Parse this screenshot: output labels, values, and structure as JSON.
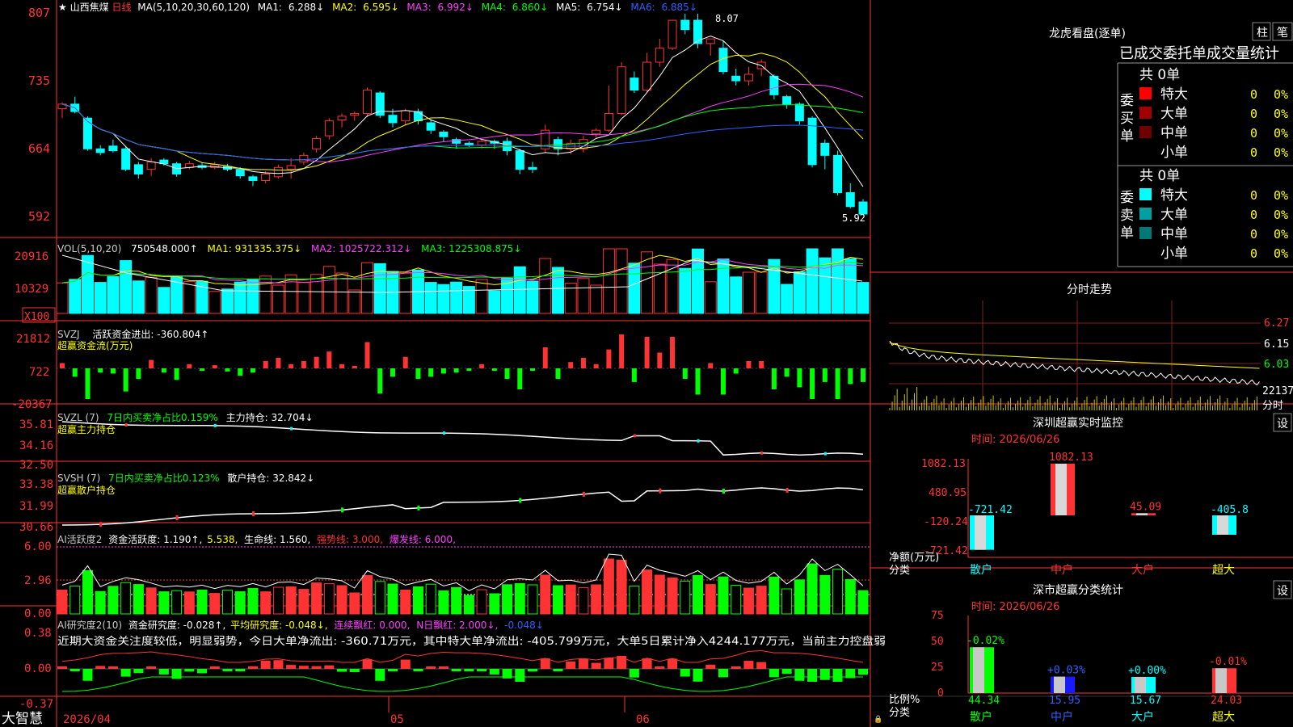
{
  "app": {
    "brand": "大智慧",
    "lock_glyph": "🔒"
  },
  "header": {
    "star": "★",
    "stock": "山西焦煤",
    "period": "日线",
    "ma_spec": "MA(5,10,20,30,60,120)",
    "ma1_label": "MA1:",
    "ma1_val": "6.288↓",
    "ma2_label": "MA2:",
    "ma2_val": "6.595↓",
    "ma3_label": "MA3:",
    "ma3_val": "6.992↓",
    "ma4_label": "MA4:",
    "ma4_val": "6.860↓",
    "ma5_label": "MA5:",
    "ma5_val": "6.754↓",
    "ma6_label": "MA6:",
    "ma6_val": "6.885↓"
  },
  "price_axis": [
    "807",
    "735",
    "664",
    "592"
  ],
  "price_marks": {
    "high": "8.07",
    "low": "5.92"
  },
  "vol": {
    "label": "VOL(5,10,20)",
    "val": "750548.000↑",
    "ma1": "MA1: 931335.375↓",
    "ma2": "MA2: 1025722.312↓",
    "ma3": "MA3: 1225308.875↓",
    "axis": [
      "20916",
      "10329"
    ],
    "unit": "X100"
  },
  "svzj": {
    "label": "SVZJ",
    "desc": "活跃资金进出: -360.804↑",
    "title": "超赢资金流(万元)",
    "axis": [
      "21812",
      "722",
      "-20367"
    ]
  },
  "svzl": {
    "label": "SVZL (7)",
    "desc": "7日内买卖净占比0.159%",
    "hold": "主力持仓: 32.704↓",
    "title": "超赢主力持仓",
    "axis": [
      "35.81",
      "34.16",
      "32.50"
    ]
  },
  "svsh": {
    "label": "SVSH (7)",
    "desc": "7日内买卖净占比0.123%",
    "hold": "散户持仓: 32.842↓",
    "title": "超赢散户持仓",
    "axis": [
      "33.38",
      "31.99",
      "30.66"
    ]
  },
  "ai_act": {
    "label": "AI活跃度2",
    "a": "资金活跃度: 1.190↑,",
    "b": "5.538,",
    "c": "生命线: 1.560,",
    "d": "强势线: 3.000,",
    "e": "爆发线: 6.000,",
    "axis": [
      "6.00",
      "2.96",
      "0.00"
    ]
  },
  "ai_res": {
    "label": "AI研究度2(10)",
    "a": "资金研究度: -0.028↑,",
    "b": "平均研究度: -0.048↓,",
    "c": "连续飘红: 0.000,",
    "d": "N日飘红: 2.000↓,",
    "e": "-0.048↓",
    "comment": "近期大资金关注度较低，明显弱势，今日大单净流出: -360.71万元，其中特大单净流出: -405.799万元，大单5日累计净入4244.177万元，当前主力控盘弱",
    "axis": [
      "0.38",
      "0.00",
      "-0.37"
    ]
  },
  "date_axis": [
    "2026/04",
    "05",
    "06"
  ],
  "longhu": {
    "title": "龙虎看盘(逐单)",
    "btn_zhu": "柱",
    "btn_bi": "笔",
    "subtitle": "已成交委托单成交量统计",
    "buy_label": "委买单",
    "sell_label": "委卖单",
    "buy_total": "共 0单",
    "sell_total": "共 0单",
    "buy_rows": [
      {
        "name": "特大",
        "count": "0",
        "pct": "0%",
        "color": "#ff0000"
      },
      {
        "name": "大单",
        "count": "0",
        "pct": "0%",
        "color": "#a00000"
      },
      {
        "name": "中单",
        "count": "0",
        "pct": "0%",
        "color": "#700000"
      },
      {
        "name": "小单",
        "count": "0",
        "pct": "0%",
        "color": ""
      }
    ],
    "sell_rows": [
      {
        "name": "特大",
        "count": "0",
        "pct": "0%",
        "color": "#00ffff"
      },
      {
        "name": "大单",
        "count": "0",
        "pct": "0%",
        "color": "#00a0a0"
      },
      {
        "name": "中单",
        "count": "0",
        "pct": "0%",
        "color": "#007878"
      },
      {
        "name": "小单",
        "count": "0",
        "pct": "0%",
        "color": ""
      }
    ]
  },
  "intraday": {
    "title": "分时走势",
    "axis": [
      "6.27",
      "6.15",
      "6.03"
    ],
    "vol_top": "22137",
    "vol_unit": "分时"
  },
  "sz_monitor": {
    "title": "深圳超赢实时监控",
    "btn": "设",
    "time": "时间: 2026/06/26",
    "axis": [
      "1082.13",
      "480.95",
      "-120.24",
      "-721.42"
    ],
    "ylabel1": "净额(万元)",
    "ylabel2": "分类",
    "cats": [
      "散户",
      "中户",
      "大户",
      "超大"
    ],
    "values": [
      "-721.42",
      "1082.13",
      "45.09",
      "-405.8"
    ],
    "values_num": [
      -721.42,
      1082.13,
      45.09,
      -405.8
    ]
  },
  "sz_stat": {
    "title": "深市超赢分类统计",
    "btn": "设",
    "time": "时间: 2026/06/26",
    "axis": [
      "75",
      "50",
      "25",
      "0"
    ],
    "ylabel1": "比例%",
    "ylabel2": "分类",
    "cats": [
      "散户",
      "中户",
      "大户",
      "超大"
    ],
    "pcts": [
      "44.34",
      "15.95",
      "15.67",
      "24.03"
    ],
    "pcts_num": [
      44.34,
      15.95,
      15.67,
      24.03
    ],
    "changes": [
      "-0.02%",
      "+0.03%",
      "+0.00%",
      "-0.01%"
    ]
  },
  "chart_data": {
    "type": "candlestick",
    "title": "山西焦煤 日线",
    "x": [
      "2026/04",
      "05",
      "06"
    ],
    "ylim": [
      5.92,
      8.07
    ],
    "candles": [
      [
        7.05,
        7.1,
        6.95,
        7.12
      ],
      [
        7.1,
        7.02,
        7.0,
        7.18
      ],
      [
        6.95,
        6.62,
        6.6,
        6.97
      ],
      [
        6.62,
        6.58,
        6.55,
        6.66
      ],
      [
        6.65,
        6.6,
        6.58,
        6.72
      ],
      [
        6.62,
        6.4,
        6.38,
        6.64
      ],
      [
        6.45,
        6.35,
        6.3,
        6.48
      ],
      [
        6.4,
        6.48,
        6.33,
        6.52
      ],
      [
        6.5,
        6.46,
        6.44,
        6.52
      ],
      [
        6.46,
        6.35,
        6.32,
        6.48
      ],
      [
        6.42,
        6.46,
        6.4,
        6.49
      ],
      [
        6.44,
        6.42,
        6.4,
        6.47
      ],
      [
        6.42,
        6.45,
        6.4,
        6.48
      ],
      [
        6.43,
        6.4,
        6.38,
        6.46
      ],
      [
        6.4,
        6.33,
        6.3,
        6.42
      ],
      [
        6.32,
        6.28,
        6.22,
        6.34
      ],
      [
        6.28,
        6.35,
        6.25,
        6.38
      ],
      [
        6.32,
        6.42,
        6.3,
        6.45
      ],
      [
        6.4,
        6.44,
        6.3,
        6.52
      ],
      [
        6.48,
        6.55,
        6.45,
        6.58
      ],
      [
        6.62,
        6.73,
        6.58,
        6.76
      ],
      [
        6.76,
        6.92,
        6.72,
        6.95
      ],
      [
        6.93,
        6.97,
        6.85,
        7.0
      ],
      [
        6.98,
        7.0,
        6.92,
        7.02
      ],
      [
        7.0,
        7.25,
        6.96,
        7.28
      ],
      [
        7.22,
        6.98,
        6.95,
        7.24
      ],
      [
        6.98,
        6.9,
        6.85,
        7.05
      ],
      [
        6.92,
        7.03,
        6.88,
        7.05
      ],
      [
        7.02,
        6.92,
        6.88,
        7.05
      ],
      [
        6.9,
        6.82,
        6.78,
        6.94
      ],
      [
        6.8,
        6.75,
        6.7,
        6.82
      ],
      [
        6.72,
        6.68,
        6.62,
        6.74
      ],
      [
        6.68,
        6.66,
        6.64,
        6.7
      ],
      [
        6.66,
        6.7,
        6.62,
        6.72
      ],
      [
        6.7,
        6.68,
        6.62,
        6.72
      ],
      [
        6.7,
        6.6,
        6.55,
        6.74
      ],
      [
        6.6,
        6.4,
        6.35,
        6.62
      ],
      [
        6.42,
        6.4,
        6.36,
        6.48
      ],
      [
        6.62,
        6.82,
        6.58,
        6.88
      ],
      [
        6.72,
        6.62,
        6.55,
        6.75
      ],
      [
        6.62,
        6.68,
        6.56,
        6.72
      ],
      [
        6.62,
        6.72,
        6.58,
        6.76
      ],
      [
        6.78,
        6.82,
        6.74,
        6.84
      ],
      [
        6.82,
        7.0,
        6.8,
        7.3
      ],
      [
        7.0,
        7.5,
        6.98,
        7.55
      ],
      [
        7.38,
        7.25,
        7.22,
        7.45
      ],
      [
        7.25,
        7.55,
        7.22,
        7.65
      ],
      [
        7.55,
        7.7,
        7.5,
        7.8
      ],
      [
        7.7,
        8.0,
        7.68,
        8.0
      ],
      [
        8.0,
        7.9,
        7.85,
        8.07
      ],
      [
        8.0,
        7.75,
        7.7,
        8.07
      ],
      [
        7.75,
        7.8,
        7.62,
        7.8
      ],
      [
        7.7,
        7.45,
        7.42,
        7.78
      ],
      [
        7.4,
        7.35,
        7.3,
        7.48
      ],
      [
        7.35,
        7.42,
        7.3,
        7.5
      ],
      [
        7.48,
        7.55,
        7.4,
        7.58
      ],
      [
        7.4,
        7.2,
        7.15,
        7.42
      ],
      [
        7.18,
        7.1,
        7.05,
        7.2
      ],
      [
        7.1,
        6.92,
        6.88,
        7.12
      ],
      [
        6.95,
        6.45,
        6.42,
        6.97
      ],
      [
        6.68,
        6.55,
        6.4,
        6.72
      ],
      [
        6.55,
        6.15,
        6.12,
        6.6
      ],
      [
        6.15,
        6.0,
        5.98,
        6.25
      ],
      [
        6.05,
        5.92,
        5.92,
        6.08
      ]
    ]
  }
}
